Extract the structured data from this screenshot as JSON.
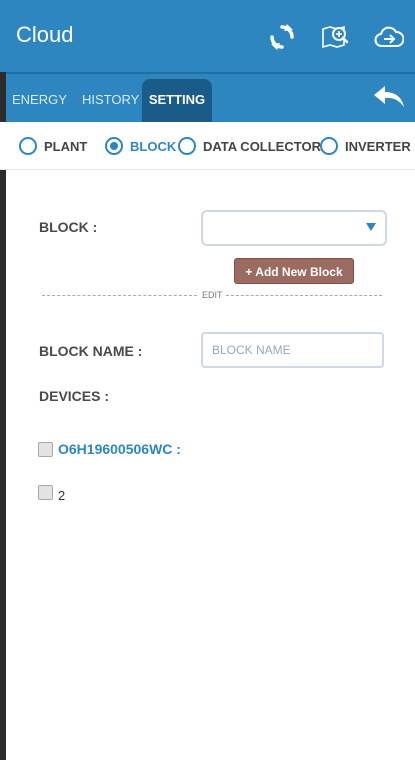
{
  "app": {
    "title": "Cloud"
  },
  "toolbar_icons": [
    "refresh-icon",
    "search-map-icon",
    "cloud-logout-icon"
  ],
  "tabs": [
    {
      "label": "ENERGY",
      "active": false
    },
    {
      "label": "HISTORY",
      "active": false
    },
    {
      "label": "SETTING",
      "active": true
    }
  ],
  "radios": [
    {
      "label": "PLANT",
      "checked": false
    },
    {
      "label": "BLOCK",
      "checked": true
    },
    {
      "label": "DATA COLLECTOR",
      "checked": false
    },
    {
      "label": "INVERTER",
      "checked": false
    }
  ],
  "form": {
    "block_label": "BLOCK :",
    "block_value": "",
    "add_button": "+ Add New Block",
    "divider_text": "EDIT",
    "block_name_label": "BLOCK NAME :",
    "block_name_placeholder": "BLOCK NAME",
    "devices_label": "DEVICES :"
  },
  "devices": [
    {
      "label": "O6H19600506WC :",
      "checked": false
    },
    {
      "label": "2",
      "checked": false
    }
  ],
  "colors": {
    "primary": "#2e86c1",
    "tab_active": "#1a5b89",
    "add_button": "#9b6b62"
  }
}
